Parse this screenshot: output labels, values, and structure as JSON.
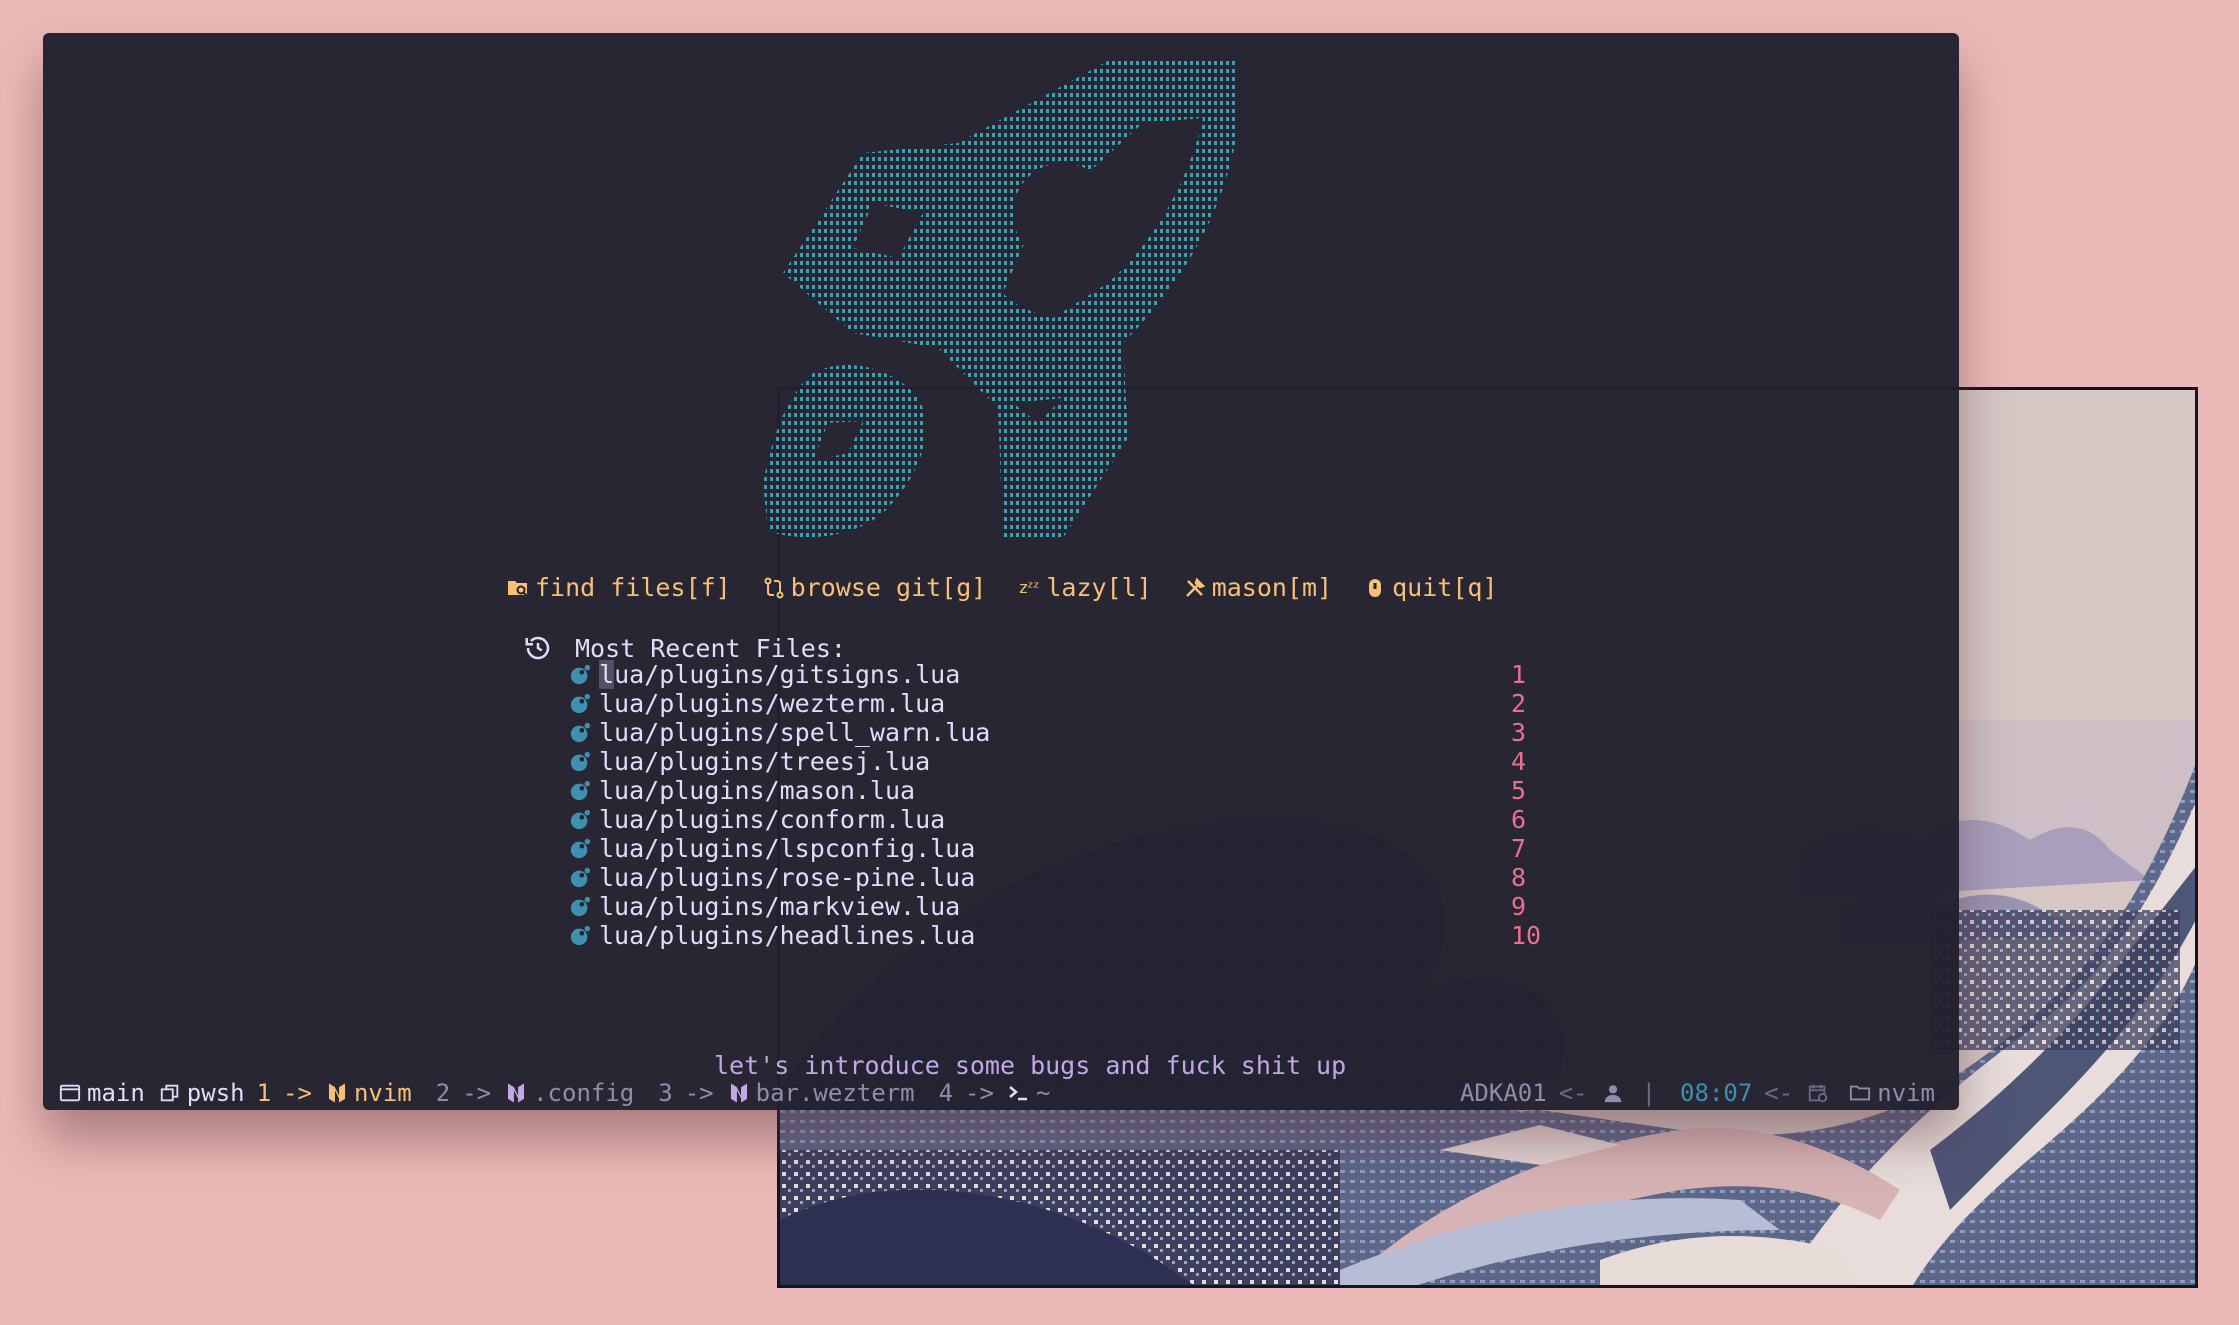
{
  "dashboard": {
    "shortcuts": [
      {
        "label": "find files[f]",
        "icon": "folder-search-icon"
      },
      {
        "label": "browse git[g]",
        "icon": "git-compare-icon"
      },
      {
        "label": "lazy[l]",
        "icon": "sleep-zzz-icon"
      },
      {
        "label": "mason[m]",
        "icon": "tools-icon"
      },
      {
        "label": "quit[q]",
        "icon": "power-icon"
      }
    ],
    "recent_title": "Most Recent Files:",
    "recent_files": [
      {
        "path": "lua/plugins/gitsigns.lua",
        "key": "1"
      },
      {
        "path": "lua/plugins/wezterm.lua",
        "key": "2"
      },
      {
        "path": "lua/plugins/spell_warn.lua",
        "key": "3"
      },
      {
        "path": "lua/plugins/treesj.lua",
        "key": "4"
      },
      {
        "path": "lua/plugins/mason.lua",
        "key": "5"
      },
      {
        "path": "lua/plugins/conform.lua",
        "key": "6"
      },
      {
        "path": "lua/plugins/lspconfig.lua",
        "key": "7"
      },
      {
        "path": "lua/plugins/rose-pine.lua",
        "key": "8"
      },
      {
        "path": "lua/plugins/markview.lua",
        "key": "9"
      },
      {
        "path": "lua/plugins/headlines.lua",
        "key": "10"
      }
    ],
    "footer": "let's introduce some bugs and fuck shit up"
  },
  "statusbar": {
    "workspace": "main",
    "tabs": [
      {
        "title": "pwsh",
        "index": "1",
        "arrow": "->",
        "icon": "window-restore-icon"
      },
      {
        "title": "nvim",
        "index": "2",
        "arrow": "->",
        "icon": "neovim-icon"
      },
      {
        "title": ".config",
        "index": "3",
        "arrow": "->",
        "icon": "neovim-icon"
      },
      {
        "title": "bar.wezterm",
        "index": "4",
        "arrow": "->",
        "icon": "neovim-icon"
      },
      {
        "title": "~",
        "icon": "terminal-prompt-icon"
      }
    ],
    "hostname": "ADKA01",
    "arrow_left": "<-",
    "separator": "|",
    "time": "08:07",
    "cwd": "nvim"
  },
  "colors": {
    "background": "#ebb9b7",
    "terminal_bg": "#21202e",
    "gold": "#f6c177",
    "love": "#eb6f92",
    "iris": "#c4a7e7",
    "pine": "#3e8fb0",
    "text": "#e0def4"
  }
}
